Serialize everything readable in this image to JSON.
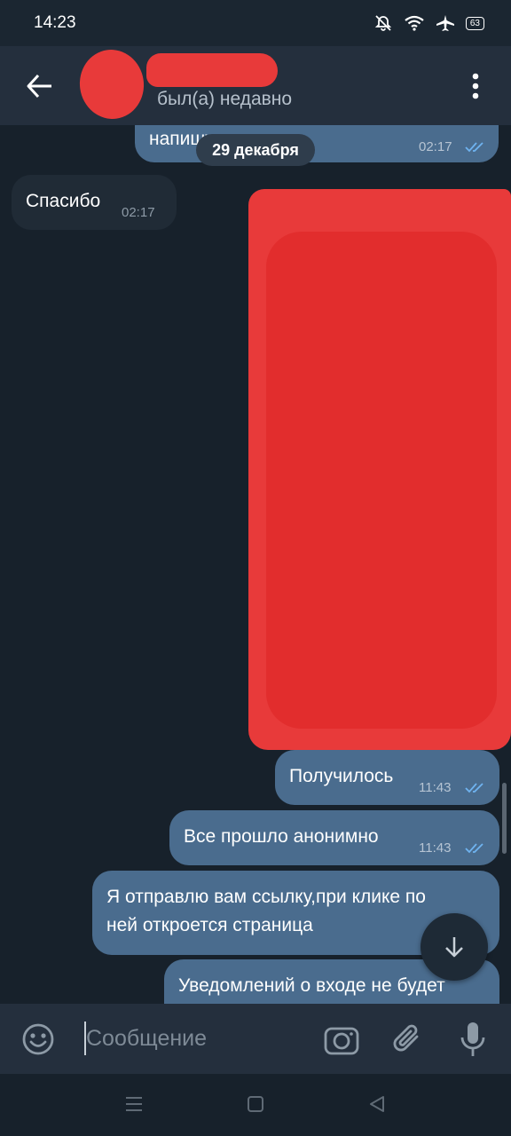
{
  "status_bar": {
    "time": "14:23",
    "battery": "63",
    "icons": [
      "mute-icon",
      "wifi-icon",
      "airplane-icon",
      "battery-icon"
    ]
  },
  "header": {
    "status": "был(а) недавно",
    "icons": [
      "back-arrow-icon",
      "more-vert-icon"
    ]
  },
  "chat": {
    "date_separator": "29 декабря",
    "messages": [
      {
        "direction": "out",
        "text": "напишу",
        "time": "02:17",
        "read": true
      },
      {
        "direction": "in",
        "text": "Спасибо",
        "time": "02:17"
      },
      {
        "direction": "out",
        "text": "Получилось",
        "time": "11:43",
        "read": true
      },
      {
        "direction": "out",
        "text": "Все прошло анонимно",
        "time": "11:43",
        "read": true
      },
      {
        "direction": "out",
        "text_line1": "Я отправлю вам ссылку,при клике по",
        "text_line2": "ней откроется страница",
        "read": true
      },
      {
        "direction": "out",
        "text": "Уведомлений о входе не будет"
      }
    ],
    "scroll_button_icon": "arrow-down-icon"
  },
  "input_bar": {
    "placeholder": "Сообщение",
    "icons": [
      "emoji-icon",
      "camera-icon",
      "attach-icon",
      "mic-icon"
    ]
  },
  "nav_bar": {
    "icons": [
      "recents-icon",
      "home-icon",
      "back-icon"
    ]
  },
  "colors": {
    "background": "#17212b",
    "header": "#242f3d",
    "outgoing_bubble": "#4a6c8e",
    "incoming_bubble": "#202b36",
    "read_ticks": "#6fb3f0",
    "redaction": "#e83a3a"
  }
}
